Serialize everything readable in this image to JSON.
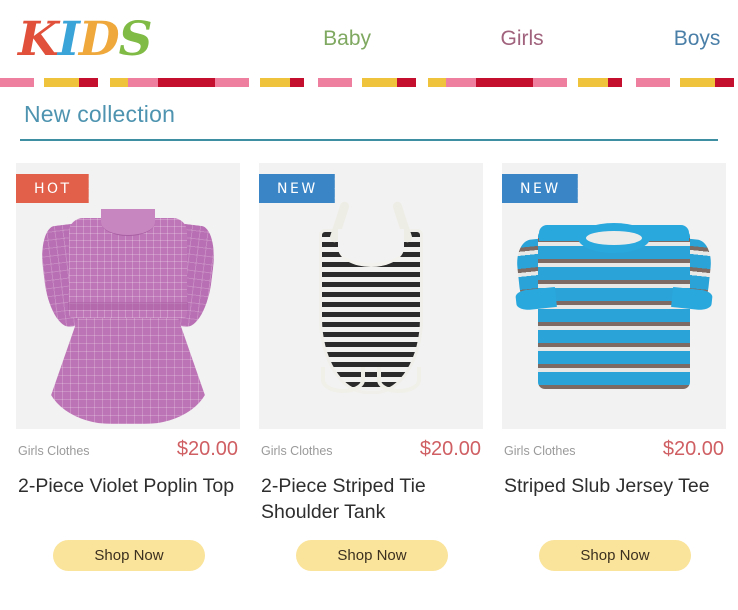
{
  "header": {
    "logo": {
      "text": "KIDS",
      "letters": [
        "K",
        "I",
        "D",
        "S"
      ],
      "colors": [
        "#e0503a",
        "#3aa3d8",
        "#efa83b",
        "#7fbb45"
      ]
    },
    "nav": [
      {
        "label": "Baby",
        "color": "#7fa860"
      },
      {
        "label": "Girls",
        "color": "#a0627c"
      },
      {
        "label": "Boys",
        "color": "#4a7fa8"
      }
    ]
  },
  "divider": {
    "colors": [
      "#ef7f9e",
      "#f0c33c",
      "#c4102e"
    ]
  },
  "section": {
    "title": "New collection",
    "title_color": "#4e94b0",
    "rule_color": "#3f8fa3"
  },
  "products": [
    {
      "badge": "HOT",
      "badge_color": "#e2604a",
      "category": "Girls Clothes",
      "price": "$20.00",
      "title": "2-Piece Violet Poplin Top",
      "cta": "Shop Now",
      "image_alt": "violet-poplin-dress"
    },
    {
      "badge": "NEW",
      "badge_color": "#3a85c6",
      "category": "Girls Clothes",
      "price": "$20.00",
      "title": "2-Piece Striped Tie Shoulder Tank",
      "cta": "Shop Now",
      "image_alt": "striped-tie-shoulder-tank"
    },
    {
      "badge": "NEW",
      "badge_color": "#3a85c6",
      "category": "Girls Clothes",
      "price": "$20.00",
      "title": "Striped Slub Jersey Tee",
      "cta": "Shop Now",
      "image_alt": "striped-slub-jersey-tee"
    }
  ]
}
